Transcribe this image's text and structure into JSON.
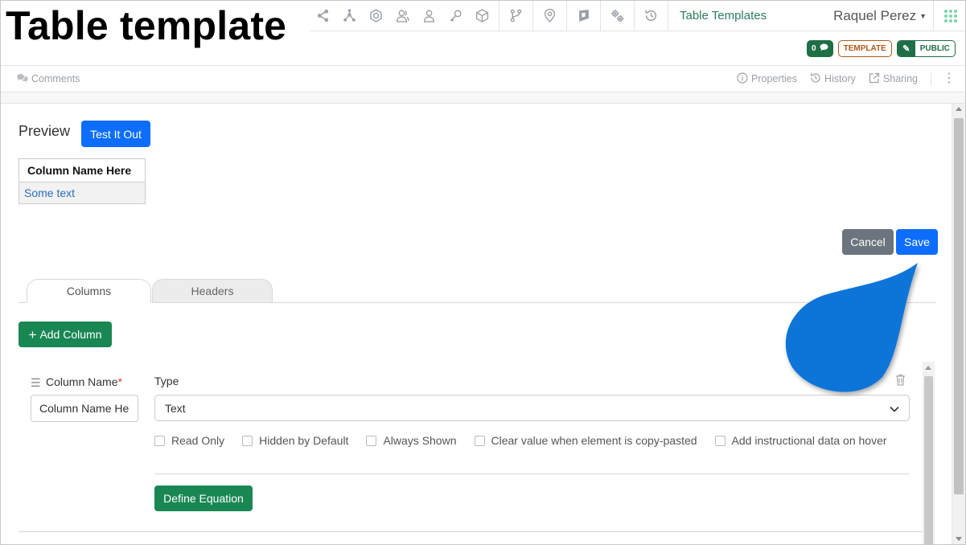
{
  "page": {
    "overlay_title": "Table template"
  },
  "topbar": {
    "section_link": "Table Templates",
    "user_name": "Raquel Perez",
    "icons": [
      "share-icon",
      "graph-icon",
      "badge-icon",
      "users-icon",
      "user-icon",
      "key-icon",
      "cube-icon",
      "branch-icon",
      "location-icon",
      "shield-icon",
      "gears-icon",
      "history-icon"
    ]
  },
  "badges": {
    "comments_count": "0",
    "template": "TEMPLATE",
    "public": "PUBLIC"
  },
  "subbar": {
    "comments": "Comments",
    "properties": "Properties",
    "history": "History",
    "sharing": "Sharing"
  },
  "preview": {
    "title": "Preview",
    "test_button": "Test It Out",
    "table_header": "Column Name Here",
    "table_cell": "Some text"
  },
  "actions": {
    "cancel": "Cancel",
    "save": "Save"
  },
  "tabs": [
    {
      "label": "Columns",
      "active": true
    },
    {
      "label": "Headers",
      "active": false
    }
  ],
  "add_column_button": "Add Column",
  "column_editor": {
    "name_label": "Column Name",
    "required_mark": "*",
    "name_value": "Column Name Here",
    "type_label": "Type",
    "type_value": "Text",
    "checkboxes": [
      {
        "label": "Read Only",
        "checked": false
      },
      {
        "label": "Hidden by Default",
        "checked": false
      },
      {
        "label": "Always Shown",
        "checked": false
      },
      {
        "label": "Clear value when element is copy-pasted",
        "checked": false
      },
      {
        "label": "Add instructional data on hover",
        "checked": false
      }
    ],
    "equation_button": "Define Equation"
  },
  "colors": {
    "primary": "#0d6efd",
    "secondary": "#6c757d",
    "success": "#198754",
    "nav_link": "#2e7d5b",
    "callout": "#0a74d9"
  }
}
